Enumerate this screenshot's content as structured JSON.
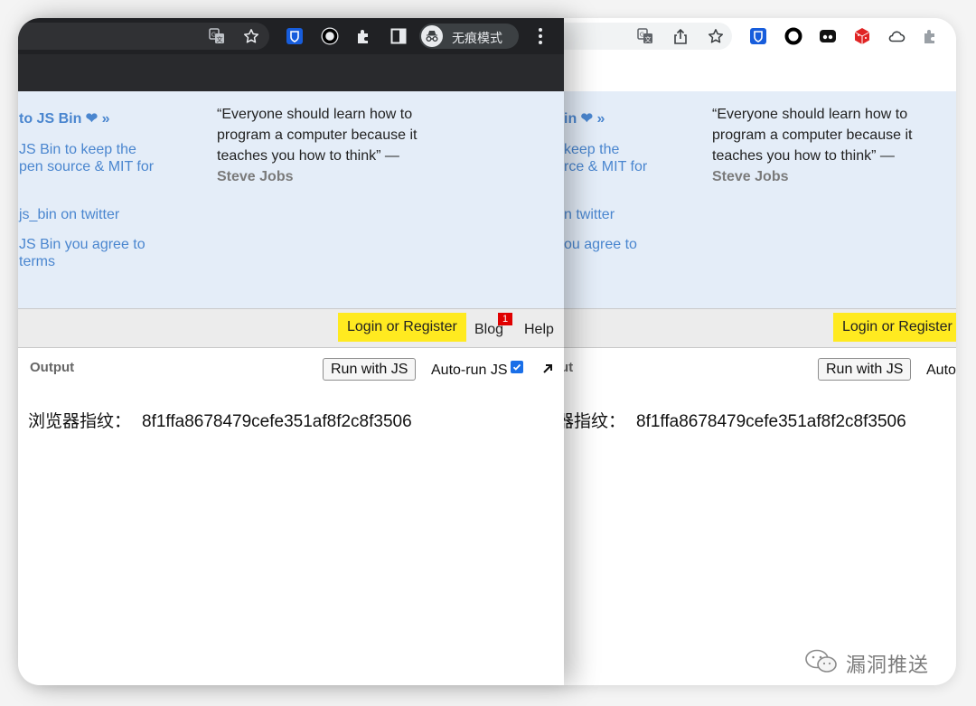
{
  "incognito_label": "无痕模式",
  "promo": {
    "left_window": {
      "title": "to JS Bin ❤ »",
      "line1": "JS Bin to keep the",
      "line2": "pen source & MIT for",
      "twitter": "js_bin on twitter",
      "terms1": "JS Bin you agree to",
      "terms2": "terms"
    },
    "right_window": {
      "title": "in ❤ »",
      "line1": "keep the",
      "line2": "rce & MIT for",
      "twitter": "n twitter",
      "terms1": "ou agree to"
    }
  },
  "quote": {
    "text_line1": "“Everyone should learn how to",
    "text_line2": "program a computer because it",
    "text_line3": "teaches you how to think” —",
    "author": "Steve Jobs"
  },
  "jsbar": {
    "login_label": "Login or Register",
    "blog_label": "Blog",
    "blog_badge": "1",
    "help_label": "Help"
  },
  "output": {
    "label": "Output",
    "label_cropped": "ut",
    "run_label": "Run with JS",
    "autorun_label": "Auto-run JS",
    "autorun_cropped": "Auto",
    "autorun_checked": true
  },
  "fingerprint": {
    "label": "浏览器指纹：",
    "label_cropped": "器指纹：",
    "value": "8f1ffa8678479cefe351af8f2c8f3506"
  },
  "watermark": {
    "text": "漏洞推送"
  },
  "colors": {
    "accent_blue": "#4a86cf",
    "login_yellow": "#ffea20",
    "panel_bg": "#e4edf8",
    "dark_toolbar": "#202124",
    "badge_red": "#e00000"
  },
  "icons": {
    "translate": "translate-icon",
    "bookmark": "star-icon",
    "share": "share-icon",
    "bitwarden": "bitwarden-shield-icon",
    "circle_ext": "ring-extension-icon",
    "extensions": "puzzle-icon",
    "sidepanel": "side-panel-icon",
    "incognito": "incognito-icon",
    "menu": "kebab-menu-icon",
    "duo": "duo-extension-icon",
    "cube": "red-cube-icon",
    "cloud": "cloud-icon",
    "popout": "arrow-up-right-icon"
  }
}
